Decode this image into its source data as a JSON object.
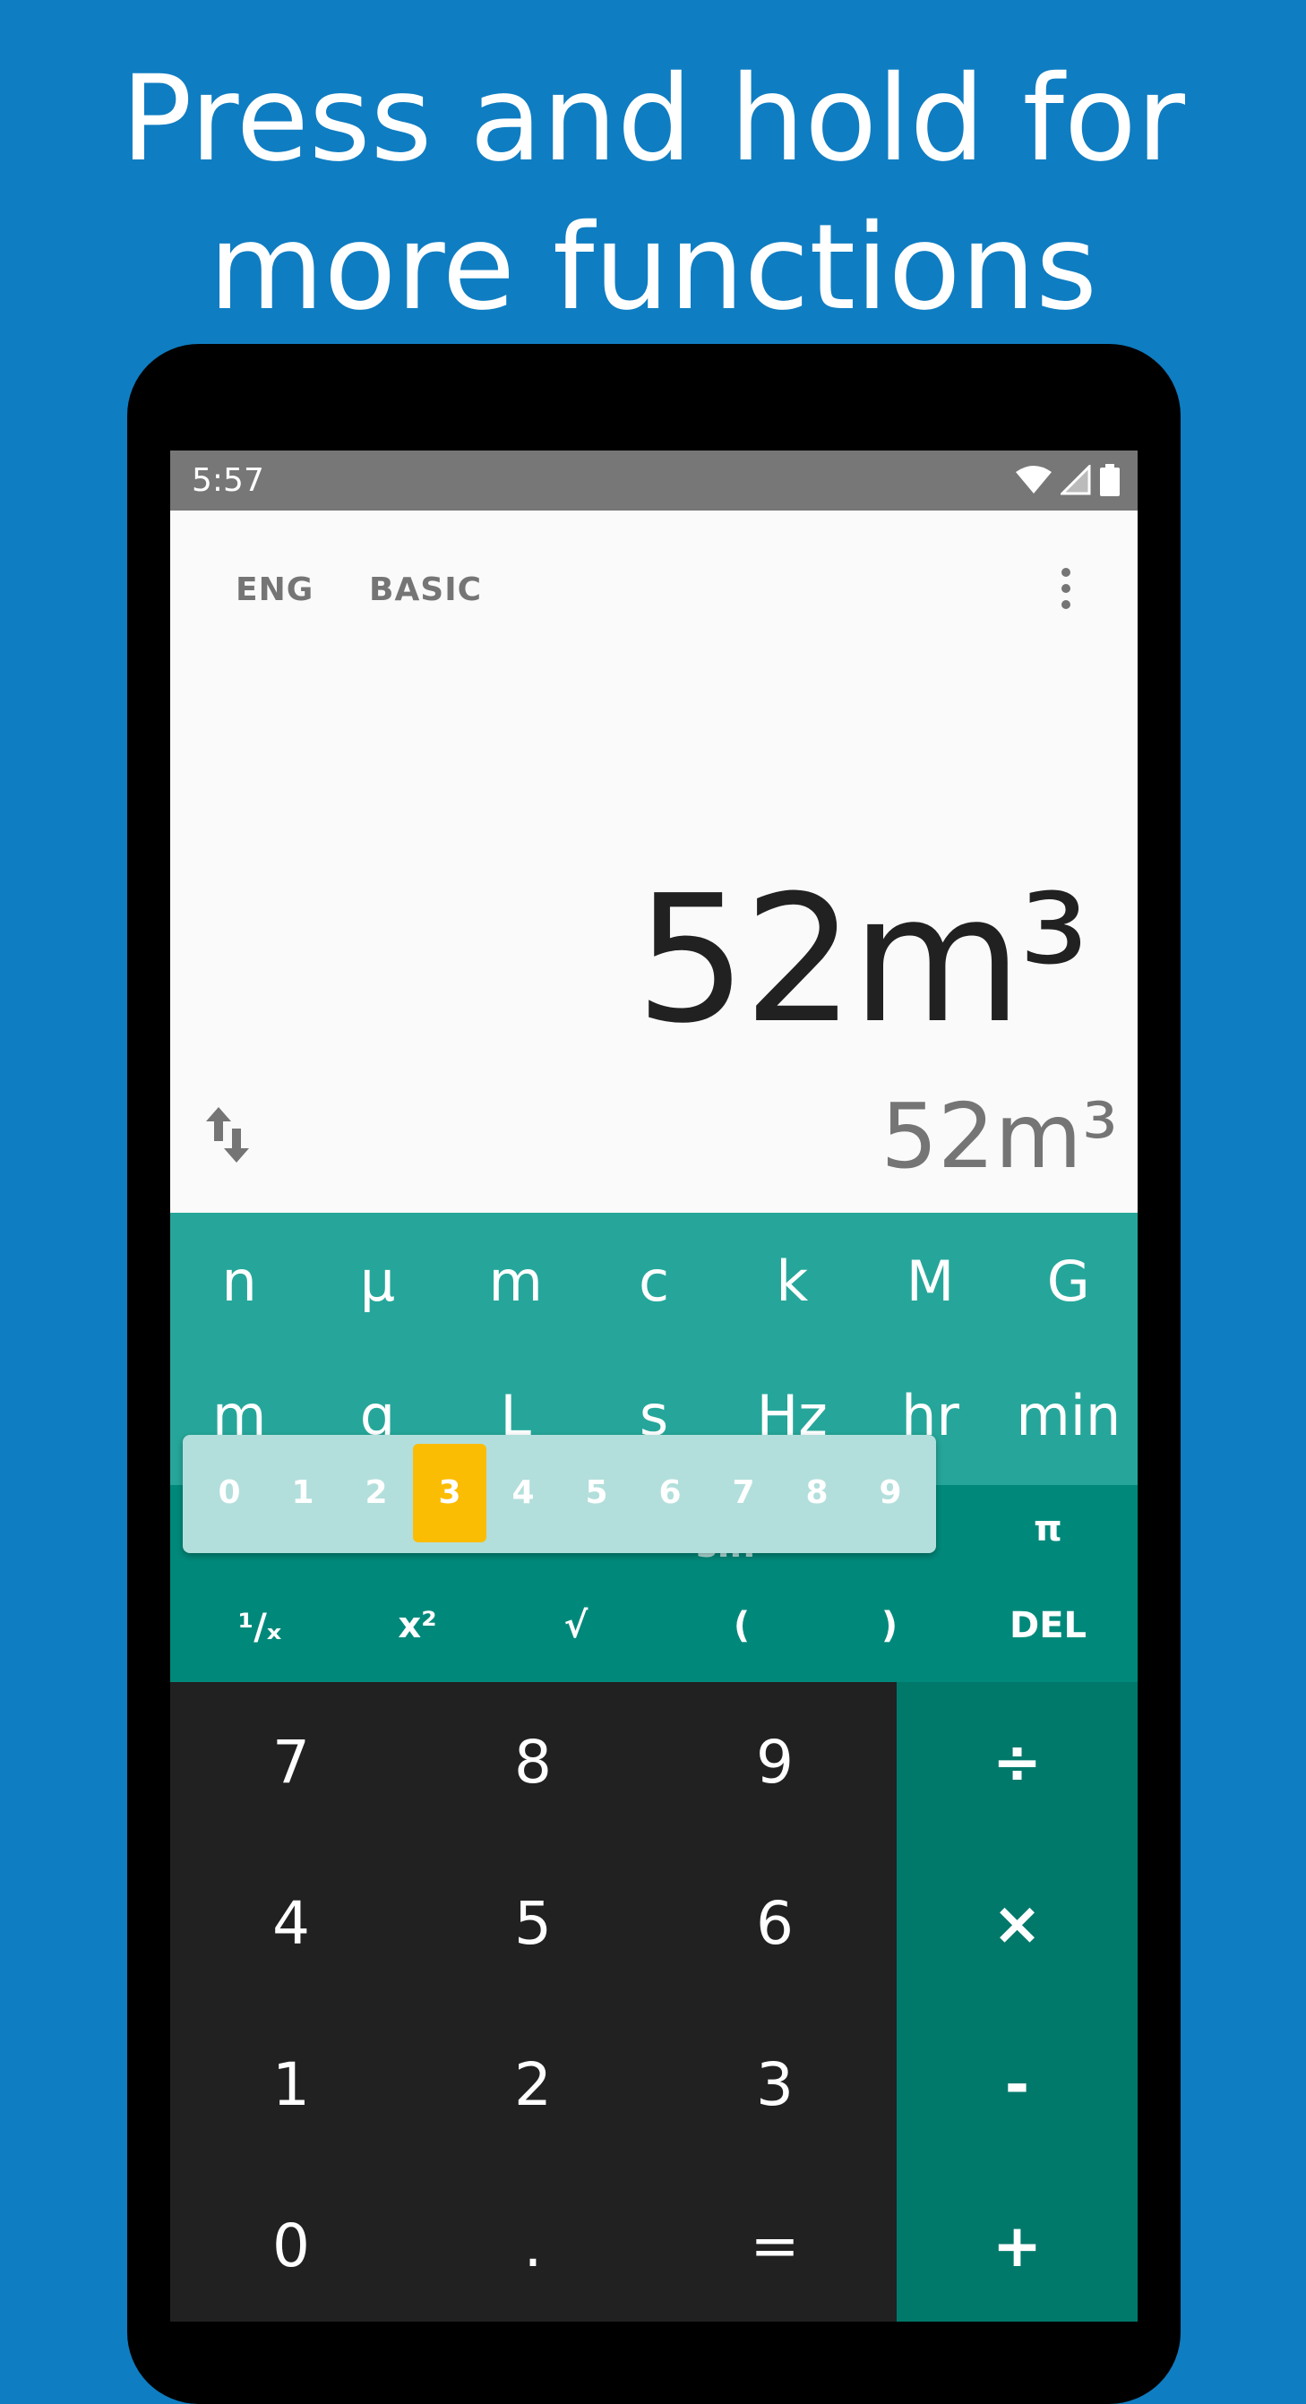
{
  "headline": {
    "line1": "Press and hold for",
    "line2": "more functions"
  },
  "status": {
    "time": "5:57"
  },
  "toolbar": {
    "mode_eng": "ENG",
    "mode_basic": "BASIC"
  },
  "display": {
    "expression": "52m³",
    "result": "52m³"
  },
  "unit_rows": {
    "row1": [
      "n",
      "μ",
      "m",
      "c",
      "k",
      "M",
      "G"
    ],
    "row2": [
      "m",
      "g",
      "L",
      "s",
      "Hz",
      "hr",
      "min"
    ]
  },
  "exponent_popup": {
    "options": [
      "0",
      "1",
      "2",
      "3",
      "4",
      "5",
      "6",
      "7",
      "8",
      "9"
    ],
    "selected": "3"
  },
  "scientific": {
    "row1_partial": "sin",
    "pi": "π",
    "reciprocal": "¹/ₓ",
    "square": "x²",
    "sqrt": "√",
    "open_paren": "(",
    "close_paren": ")",
    "del": "DEL"
  },
  "numpad": {
    "rows": [
      [
        "7",
        "8",
        "9"
      ],
      [
        "4",
        "5",
        "6"
      ],
      [
        "1",
        "2",
        "3"
      ],
      [
        "0",
        ".",
        "="
      ]
    ]
  },
  "operators": [
    "÷",
    "×",
    "-",
    "+"
  ],
  "colors": {
    "background": "#0f7dc2",
    "unit_panel": "#26a69a",
    "scientific_panel": "#00897b",
    "operator_panel": "#00796b",
    "numpad": "#212121",
    "selected": "#fbbc04"
  }
}
